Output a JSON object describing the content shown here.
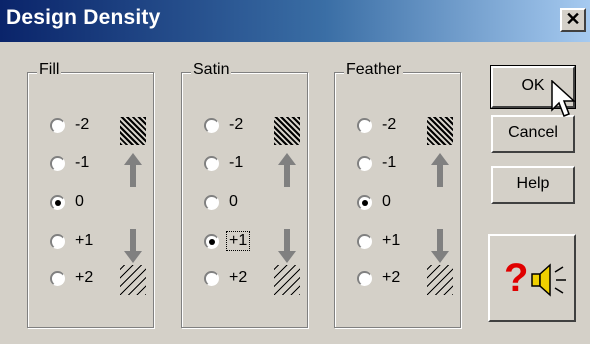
{
  "window": {
    "title": "Design Density",
    "close_glyph": "✕"
  },
  "groups": [
    {
      "legend": "Fill",
      "options": [
        "-2",
        "-1",
        "0",
        "+1",
        "+2"
      ],
      "selected": "0"
    },
    {
      "legend": "Satin",
      "options": [
        "-2",
        "-1",
        "0",
        "+1",
        "+2"
      ],
      "selected": "+1"
    },
    {
      "legend": "Feather",
      "options": [
        "-2",
        "-1",
        "0",
        "+1",
        "+2"
      ],
      "selected": "0"
    }
  ],
  "buttons": {
    "ok": "OK",
    "cancel": "Cancel",
    "help": "Help"
  },
  "help_button": {
    "glyph": "?",
    "icon": "speaker-icon"
  },
  "colors": {
    "titlebar_start": "#0a246a",
    "titlebar_end": "#a6caf0",
    "face": "#d4d0c8",
    "help_red": "#e00000"
  }
}
